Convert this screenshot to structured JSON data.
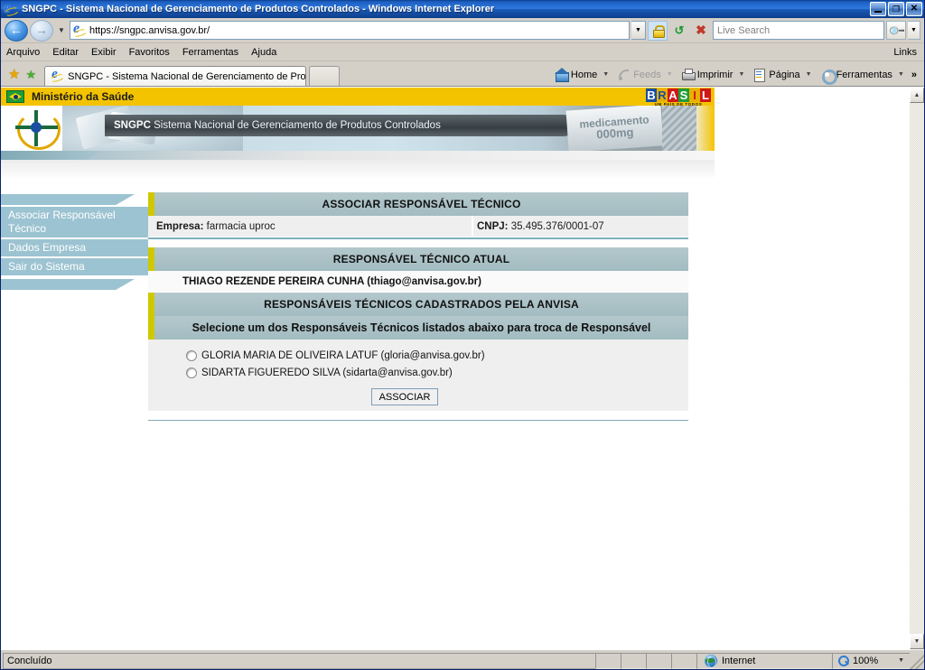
{
  "browser": {
    "title": "SNGPC - Sistema Nacional de Gerenciamento de Produtos Controlados - Windows Internet Explorer",
    "window_buttons": {
      "minimize": "_",
      "restore": "❐",
      "close": "✕"
    },
    "address": {
      "url": "https://sngpc.anvisa.gov.br/",
      "icon": "ie-page-icon",
      "dropdown_icon": "chevron-down-icon",
      "lock_icon": "lock-icon",
      "refresh_icon": "refresh-icon",
      "stop_icon": "stop-icon"
    },
    "search": {
      "placeholder": "Live Search",
      "value": "",
      "go_icon": "magnifier-icon"
    },
    "menu": [
      {
        "label": "Arquivo",
        "accel": "A"
      },
      {
        "label": "Editar",
        "accel": "E"
      },
      {
        "label": "Exibir",
        "accel": "x"
      },
      {
        "label": "Favoritos",
        "accel": "F"
      },
      {
        "label": "Ferramentas",
        "accel": "r"
      },
      {
        "label": "Ajuda",
        "accel": "j"
      }
    ],
    "links_label": "Links",
    "favorites": {
      "star_icon": "star-icon",
      "add_star_icon": "add-to-favorites-icon"
    },
    "tabs": [
      {
        "label": "SNGPC - Sistema Nacional de Gerenciamento de Produ...",
        "active": true
      }
    ],
    "new_tab_label": "",
    "commands": [
      {
        "label": "Home",
        "icon": "home-icon",
        "has_caret": true,
        "disabled": false
      },
      {
        "label": "Feeds",
        "icon": "feeds-icon",
        "has_caret": true,
        "disabled": true
      },
      {
        "label": "Imprimir",
        "icon": "printer-icon",
        "has_caret": true,
        "disabled": false
      },
      {
        "label": "Página",
        "icon": "page-icon",
        "has_caret": true,
        "disabled": false
      },
      {
        "label": "Ferramentas",
        "icon": "gear-icon",
        "has_caret": true,
        "disabled": false
      }
    ],
    "overflow_label": "»"
  },
  "site": {
    "gov_strip": {
      "title": "Ministério da Saúde",
      "flag_icon": "brazil-flag-icon",
      "brasil_letters": [
        "B",
        "R",
        "A",
        "S",
        "I",
        "L"
      ],
      "brasil_tagline": "UM PAÍS DE TODOS"
    },
    "banner": {
      "acronym": "SNGPC",
      "subtitle": "Sistema Nacional de Gerenciamento de Produtos Controlados",
      "logo_icon": "anvisa-logo-icon",
      "med_line1": "medicamento",
      "med_line2": "000mg"
    }
  },
  "sidebar": {
    "items": [
      {
        "label": "Associar Responsável Técnico"
      },
      {
        "label": "Dados Empresa"
      },
      {
        "label": "Sair do Sistema"
      }
    ]
  },
  "main": {
    "page_title": "ASSOCIAR RESPONSÁVEL TÉCNICO",
    "company": {
      "empresa_label": "Empresa:",
      "empresa_value": "farmacia uproc",
      "cnpj_label": "CNPJ:",
      "cnpj_value": "35.495.376/0001-07"
    },
    "current_section_title": "RESPONSÁVEL TÉCNICO ATUAL",
    "current_responsavel": "THIAGO REZENDE PEREIRA CUNHA (thiago@anvisa.gov.br)",
    "registered_section_title": "RESPONSÁVEIS TÉCNICOS CADASTRADOS PELA ANVISA",
    "instruction": "Selecione um dos Responsáveis Técnicos listados abaixo para troca de Responsável",
    "options": [
      {
        "label": "GLORIA MARIA DE OLIVEIRA LATUF (gloria@anvisa.gov.br)",
        "selected": false
      },
      {
        "label": "SIDARTA FIGUEREDO SILVA (sidarta@anvisa.gov.br)",
        "selected": false
      }
    ],
    "submit_label": "ASSOCIAR"
  },
  "statusbar": {
    "message": "Concluído",
    "zone_label": "Internet",
    "zone_icon": "globe-icon",
    "zoom_level": "100%",
    "zoom_icon": "zoom-icon"
  },
  "colors": {
    "gov_yellow": "#f4c300",
    "band_teal": "#a9c0c5",
    "band_accent": "#cfc800",
    "sidebar_blue": "#9cc3d1",
    "title_blue": "#2f7ae0"
  }
}
